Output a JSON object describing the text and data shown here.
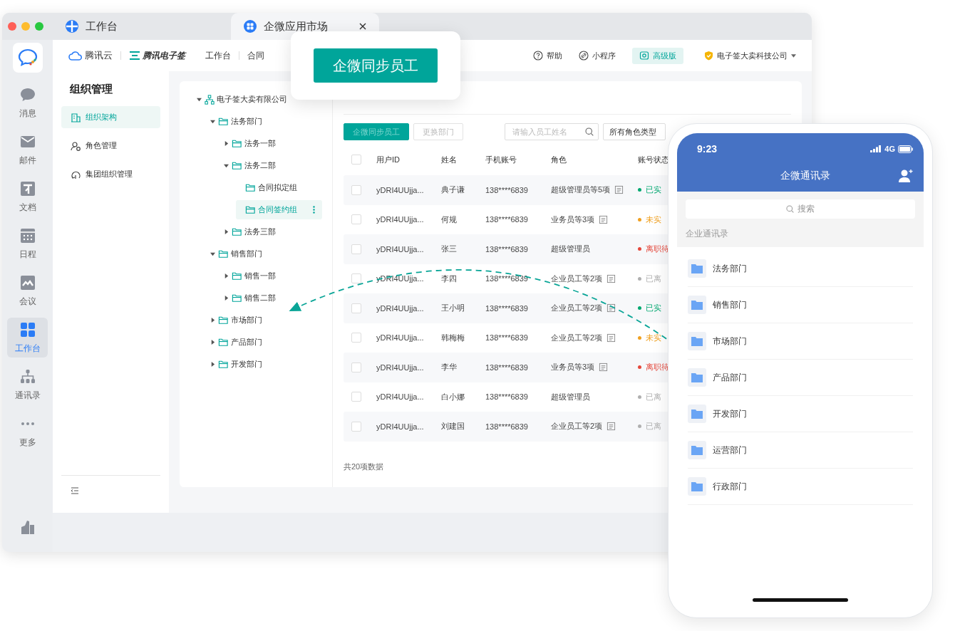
{
  "tabs": [
    {
      "label": "工作台",
      "selected": false,
      "kind": "home"
    },
    {
      "label": "企微应用市场",
      "selected": true,
      "kind": "apps"
    }
  ],
  "rail": [
    {
      "label": "消息",
      "kind": "chat",
      "selected": false
    },
    {
      "label": "邮件",
      "kind": "mail",
      "selected": false
    },
    {
      "label": "文档",
      "kind": "doc",
      "selected": false
    },
    {
      "label": "日程",
      "kind": "calendar",
      "selected": false
    },
    {
      "label": "会议",
      "kind": "meeting",
      "selected": false
    },
    {
      "label": "工作台",
      "kind": "apps",
      "selected": true
    },
    {
      "label": "通讯录",
      "kind": "contacts",
      "selected": false
    },
    {
      "label": "更多",
      "kind": "more",
      "selected": false
    }
  ],
  "topnav": {
    "brands": [
      "腾讯云",
      "腾讯电子签"
    ],
    "links": [
      "工作台",
      "合同"
    ],
    "actions": [
      {
        "label": "帮助",
        "kind": "help"
      },
      {
        "label": "小程序",
        "kind": "link"
      },
      {
        "label": "高级版",
        "kind": "badge"
      }
    ],
    "company": "电子签大卖科技公司"
  },
  "sidebar": {
    "title": "组织管理",
    "items": [
      {
        "label": "组织架构",
        "kind": "building",
        "selected": true
      },
      {
        "label": "角色管理",
        "kind": "role",
        "selected": false
      },
      {
        "label": "集团组织管理",
        "kind": "group",
        "selected": false
      }
    ]
  },
  "tree": {
    "label": "电子签大卖有限公司",
    "expanded": true,
    "selected": false,
    "children": [
      {
        "label": "法务部门",
        "expanded": true,
        "selected": false,
        "children": [
          {
            "label": "法务一部",
            "expanded": false,
            "selected": false
          },
          {
            "label": "法务二部",
            "expanded": true,
            "selected": false,
            "children": [
              {
                "label": "合同拟定组",
                "selected": false
              },
              {
                "label": "合同签约组",
                "selected": true
              }
            ]
          },
          {
            "label": "法务三部",
            "expanded": false,
            "selected": false
          }
        ]
      },
      {
        "label": "销售部门",
        "expanded": true,
        "selected": false,
        "children": [
          {
            "label": "销售一部",
            "expanded": false,
            "selected": false
          },
          {
            "label": "销售二部",
            "expanded": false,
            "selected": false
          }
        ]
      },
      {
        "label": "市场部门",
        "expanded": false,
        "selected": false
      },
      {
        "label": "产品部门",
        "expanded": false,
        "selected": false
      },
      {
        "label": "开发部门",
        "expanded": false,
        "selected": false
      }
    ]
  },
  "toolbar": {
    "buttons": [
      {
        "label": "企微同步员工",
        "kind": "primary"
      },
      {
        "label": "更换部门",
        "kind": "default"
      }
    ],
    "search": {
      "placeholder": "请输入员工姓名"
    },
    "role_filter": "所有角色类型"
  },
  "table": {
    "header_checked": false,
    "columns": [
      "用户ID",
      "姓名",
      "手机账号",
      "角色",
      "账号状态"
    ],
    "rows": [
      {
        "checked": false,
        "user_id": "yDRI4UUjja...",
        "name": "典子谦",
        "phone": "138****6839",
        "role": "超级管理员等5项",
        "role_detail": true,
        "status": "已实",
        "color": "#00a870"
      },
      {
        "checked": false,
        "user_id": "yDRI4UUjja...",
        "name": "何规",
        "phone": "138****6839",
        "role": "业务员等3项",
        "role_detail": true,
        "status": "未实",
        "color": "#f0a020"
      },
      {
        "checked": false,
        "user_id": "yDRI4UUjja...",
        "name": "张三",
        "phone": "138****6839",
        "role": "超级管理员",
        "role_detail": false,
        "status": "离职待",
        "color": "#e5483c"
      },
      {
        "checked": false,
        "user_id": "yDRI4UUjja...",
        "name": "李四",
        "phone": "138****6839",
        "role": "企业员工等2项",
        "role_detail": true,
        "status": "已离",
        "color": "#b0b0b0"
      },
      {
        "checked": false,
        "user_id": "yDRI4UUjja...",
        "name": "王小明",
        "phone": "138****6839",
        "role": "企业员工等2项",
        "role_detail": true,
        "status": "已实",
        "color": "#00a870"
      },
      {
        "checked": false,
        "user_id": "yDRI4UUjja...",
        "name": "韩梅梅",
        "phone": "138****6839",
        "role": "企业员工等2项",
        "role_detail": true,
        "status": "未实",
        "color": "#f0a020"
      },
      {
        "checked": false,
        "user_id": "yDRI4UUjja...",
        "name": "李华",
        "phone": "138****6839",
        "role": "业务员等3项",
        "role_detail": true,
        "status": "离职待",
        "color": "#e5483c"
      },
      {
        "checked": false,
        "user_id": "yDRI4UUjja...",
        "name": "白小娜",
        "phone": "138****6839",
        "role": "超级管理员",
        "role_detail": false,
        "status": "已离",
        "color": "#b0b0b0"
      },
      {
        "checked": false,
        "user_id": "yDRI4UUjja...",
        "name": "刘建国",
        "phone": "138****6839",
        "role": "企业员工等2项",
        "role_detail": true,
        "status": "已离",
        "color": "#b0b0b0"
      }
    ],
    "total": "共20项数据"
  },
  "callout": {
    "label": "企微同步员工"
  },
  "phone": {
    "time": "9:23",
    "network": "4G",
    "title": "企微通讯录",
    "search_placeholder": "搜索",
    "section": "企业通讯录",
    "departments": [
      "法务部门",
      "销售部门",
      "市场部门",
      "产品部门",
      "开发部门",
      "运营部门",
      "行政部门"
    ]
  }
}
